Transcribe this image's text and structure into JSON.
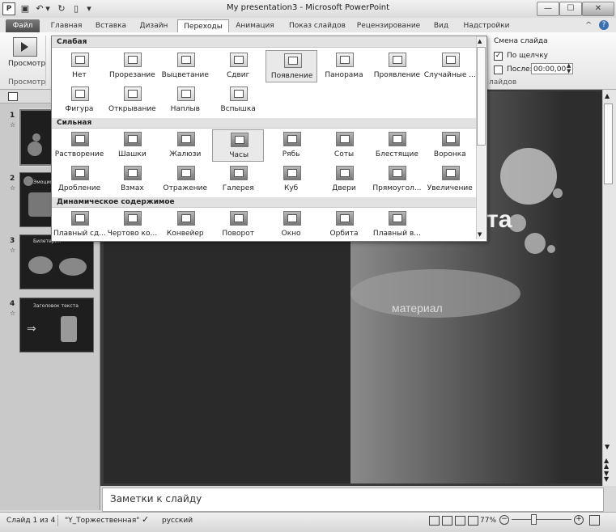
{
  "window": {
    "title": "My presentation3 - Microsoft PowerPoint"
  },
  "quick_access": {
    "app_icon": "P"
  },
  "tabs": [
    {
      "label": "Файл"
    },
    {
      "label": "Главная"
    },
    {
      "label": "Вставка"
    },
    {
      "label": "Дизайн"
    },
    {
      "label": "Переходы"
    },
    {
      "label": "Анимация"
    },
    {
      "label": "Показ слайдов"
    },
    {
      "label": "Рецензирование"
    },
    {
      "label": "Вид"
    },
    {
      "label": "Надстройки"
    }
  ],
  "ribbon": {
    "preview_button": "Просмотр",
    "preview_group": "Просмотр",
    "advance_group_title": "Смена слайда",
    "on_click_label": "По щелчку",
    "after_label": "После:",
    "after_value": "00:00,00",
    "group_suffix": "лайдов"
  },
  "gallery": {
    "sections": [
      {
        "title": "Слабая",
        "items": [
          "Нет",
          "Прорезание",
          "Выцветание",
          "Сдвиг",
          "Появление",
          "Панорама",
          "Проявление",
          "Случайные ...",
          "Фигура",
          "Открывание",
          "Наплыв",
          "Вспышка"
        ]
      },
      {
        "title": "Сильная",
        "items": [
          "Растворение",
          "Шашки",
          "Жалюзи",
          "Часы",
          "Рябь",
          "Соты",
          "Блестящие",
          "Воронка",
          "Дробление",
          "Взмах",
          "Отражение",
          "Галерея",
          "Куб",
          "Двери",
          "Прямоугол...",
          "Увеличение"
        ]
      },
      {
        "title": "Динамическое содержимое",
        "items": [
          "Плавный сд...",
          "Чертово ко...",
          "Конвейер",
          "Поворот",
          "Окно",
          "Орбита",
          "Плавный в..."
        ]
      }
    ]
  },
  "slides": [
    {
      "number": "1",
      "star": "☆"
    },
    {
      "number": "2",
      "star": "☆",
      "caption": "Эмоциональ"
    },
    {
      "number": "3",
      "star": "☆",
      "caption": "Билетерия"
    },
    {
      "number": "4",
      "star": "☆",
      "caption": "Заголовок текста"
    }
  ],
  "slide": {
    "title_fragment": "та",
    "subtitle_fragment": "материал"
  },
  "notes": {
    "placeholder": "Заметки к слайду"
  },
  "status": {
    "slide_info": "Слайд 1 из 4",
    "theme": "\"Y_Торжественная\"",
    "language": "русский",
    "zoom": "77%"
  }
}
